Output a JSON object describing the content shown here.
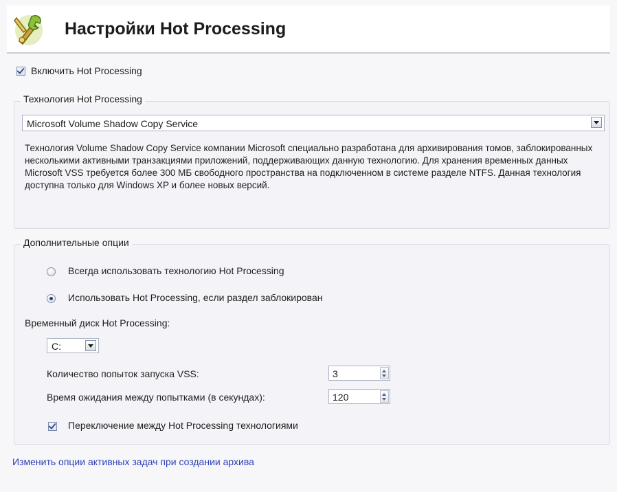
{
  "header": {
    "title": "Настройки Hot Processing",
    "icon": "tools-wrench-icon"
  },
  "enable": {
    "label": "Включить Hot Processing",
    "checked": true
  },
  "technology_group": {
    "legend": "Технология Hot Processing",
    "selected": "Microsoft Volume Shadow Copy Service",
    "description": "Технология Volume Shadow Copy Service компании Microsoft специально разработана для архивирования томов, заблокированных несколькими активными транзакциями приложений, поддерживающих данную технологию. Для хранения временных данных Microsoft VSS требуется более 300 МБ свободного пространства на подключенном в системе разделе NTFS. Данная технология доступна только для Windows XP и более новых версий."
  },
  "options_group": {
    "legend": "Дополнительные опции",
    "radio_always": {
      "label": "Всегда использовать технологию Hot Processing",
      "selected": false
    },
    "radio_locked": {
      "label": "Использовать Hot Processing, если раздел заблокирован",
      "selected": true
    },
    "temp_disk_label": "Временный диск Hot Processing:",
    "temp_disk_value": "C:",
    "vss_attempts_label": "Количество попыток запуска VSS:",
    "vss_attempts_value": "3",
    "wait_label": "Время ожидания между попытками (в секундах):",
    "wait_value": "120",
    "switch_label": "Переключение между Hot Processing технологиями",
    "switch_checked": true
  },
  "footer_link": "Изменить опции активных задач при создании архива",
  "colors": {
    "link": "#2a3fb8",
    "background": "#f7f7fa"
  }
}
